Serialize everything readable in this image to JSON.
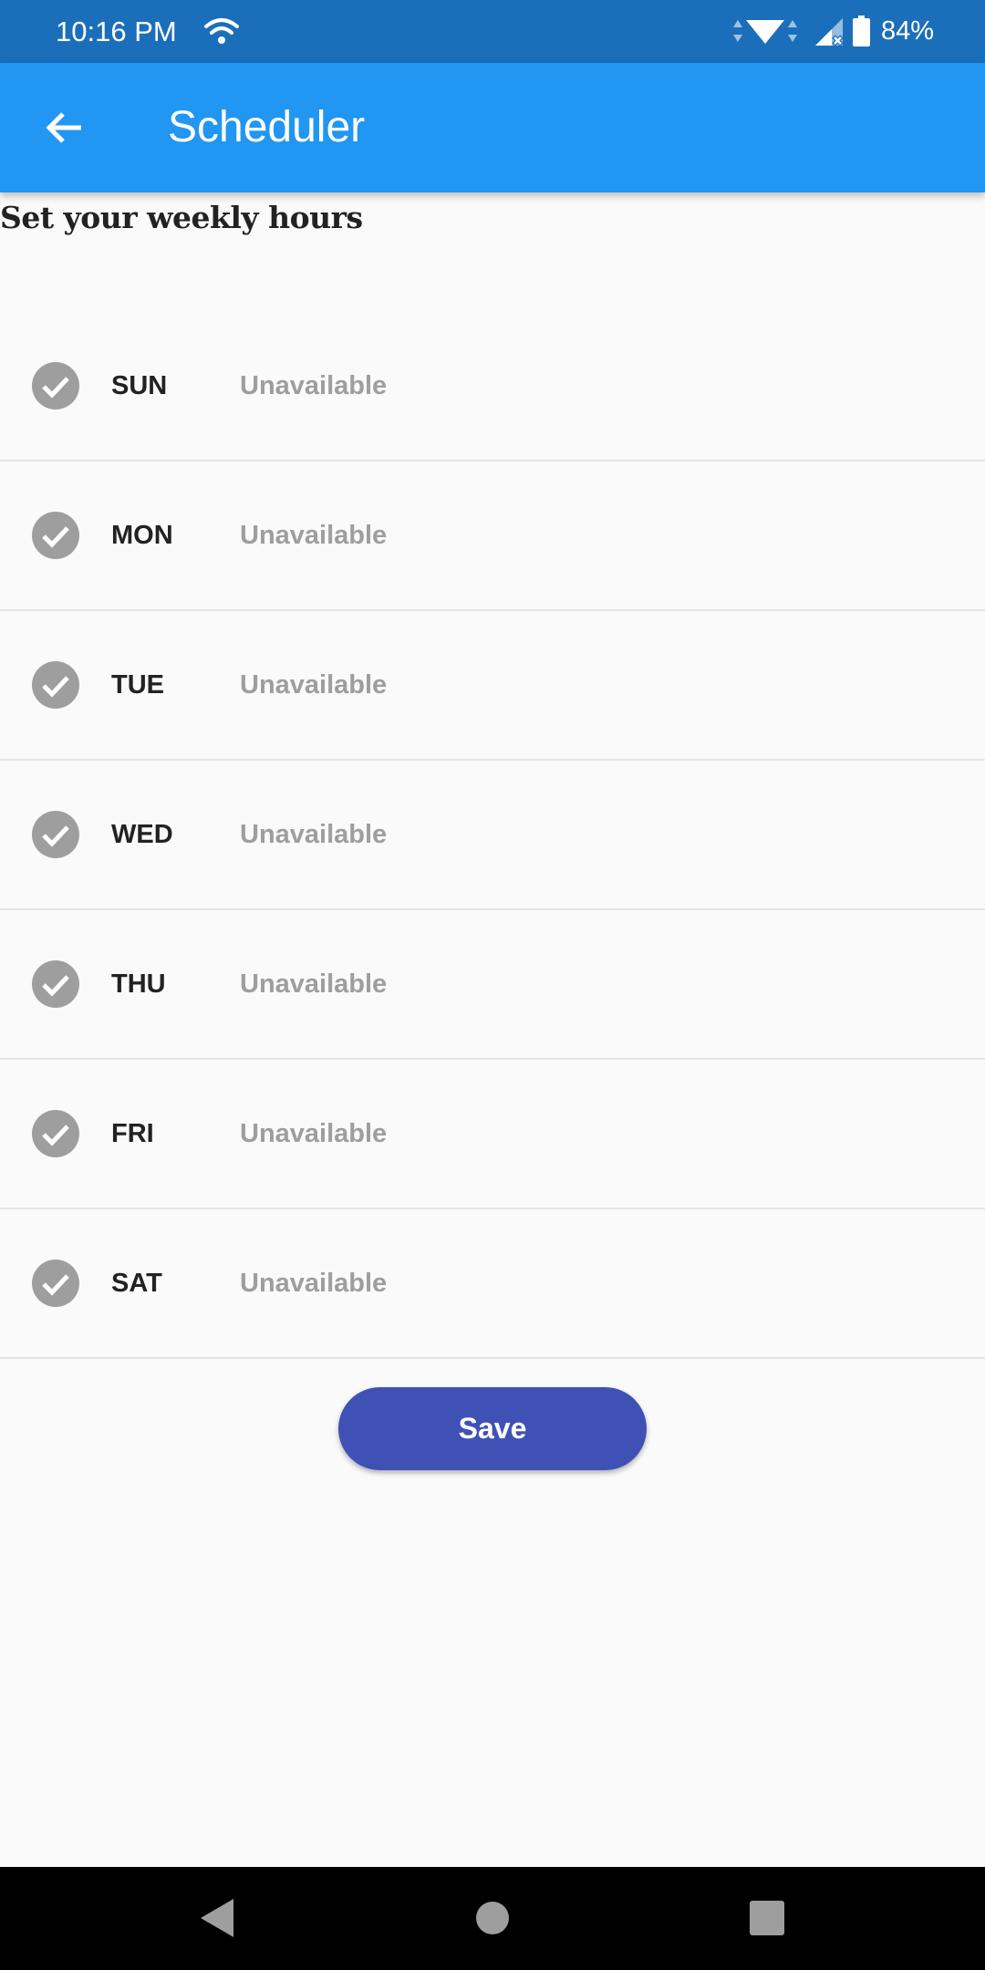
{
  "status_bar": {
    "time": "10:16 PM",
    "battery": "84%",
    "icons": [
      "wifi-icon",
      "data-arrows-icon",
      "signal-icon",
      "battery-icon"
    ]
  },
  "app_bar": {
    "title": "Scheduler",
    "back_icon": "arrow-left-icon"
  },
  "section": {
    "title": "Set your weekly hours"
  },
  "days": [
    {
      "label": "SUN",
      "status": "Unavailable"
    },
    {
      "label": "MON",
      "status": "Unavailable"
    },
    {
      "label": "TUE",
      "status": "Unavailable"
    },
    {
      "label": "WED",
      "status": "Unavailable"
    },
    {
      "label": "THU",
      "status": "Unavailable"
    },
    {
      "label": "FRI",
      "status": "Unavailable"
    },
    {
      "label": "SAT",
      "status": "Unavailable"
    }
  ],
  "actions": {
    "save_label": "Save"
  },
  "colors": {
    "status_bar": "#1b6fba",
    "app_bar": "#2196f3",
    "save_button": "#3f51b5",
    "check_circle": "#9e9e9e",
    "status_text": "#9e9e9e",
    "background": "#fafafa"
  },
  "nav_bar": {
    "icons": [
      "nav-back-icon",
      "nav-home-icon",
      "nav-recents-icon"
    ]
  }
}
